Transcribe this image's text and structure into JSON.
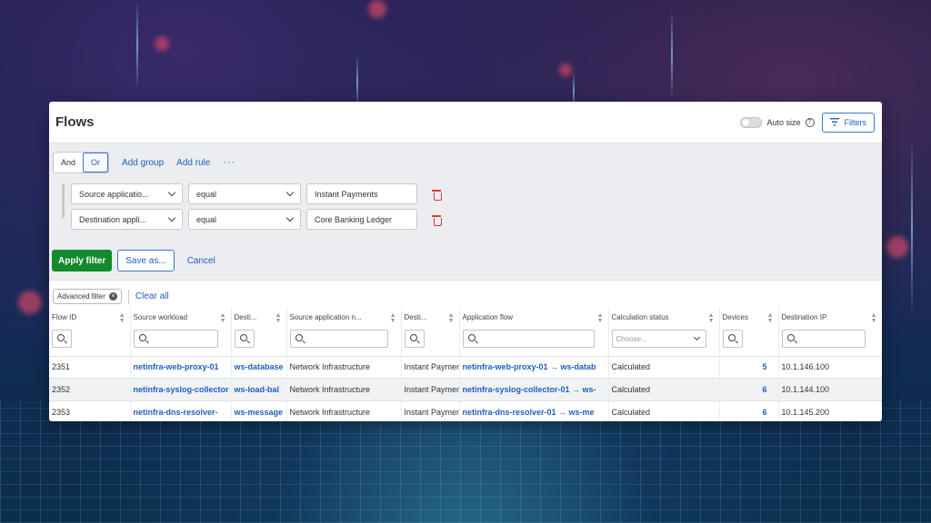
{
  "header": {
    "title": "Flows",
    "auto_size_label": "Auto size",
    "help_icon": "?",
    "filters_label": "Filters"
  },
  "filter_builder": {
    "logic": {
      "and": "And",
      "or": "Or",
      "selected": "Or"
    },
    "add_group": "Add group",
    "add_rule": "Add rule",
    "more": "···",
    "rules": [
      {
        "field": "Source applicatio...",
        "operator": "equal",
        "value": "Instant Payments"
      },
      {
        "field": "Destination appli...",
        "operator": "equal",
        "value": "Core Banking Ledger"
      }
    ],
    "apply": "Apply filter",
    "save_as": "Save as...",
    "cancel": "Cancel"
  },
  "chips": {
    "advanced_filter": "Advanced filter",
    "clear_all": "Clear all"
  },
  "table": {
    "columns": [
      {
        "label": "Flow ID"
      },
      {
        "label": "Source workload"
      },
      {
        "label": "Desti..."
      },
      {
        "label": "Source application n..."
      },
      {
        "label": "Desti..."
      },
      {
        "label": "Application flow"
      },
      {
        "label": "Calculation status",
        "placeholder": "Choose..."
      },
      {
        "label": "Devices"
      },
      {
        "label": "Destination IP"
      }
    ],
    "rows": [
      {
        "flow_id": "2351",
        "source_workload": "netinfra-web-proxy-01",
        "destination": "ws-database",
        "source_app": "Network Infrastructure",
        "dest_app": "Instant Payments",
        "app_flow": "netinfra-web-proxy-01 → ws-datab",
        "status": "Calculated",
        "devices": "5",
        "dest_ip": "10.1.146.100"
      },
      {
        "flow_id": "2352",
        "source_workload": "netinfra-syslog-collector",
        "destination": "ws-load-bal",
        "source_app": "Network Infrastructure",
        "dest_app": "Instant Payments",
        "app_flow": "netinfra-syslog-collector-01 → ws-",
        "status": "Calculated",
        "devices": "6",
        "dest_ip": "10.1.144.100"
      },
      {
        "flow_id": "2353",
        "source_workload": "netinfra-dns-resolver-",
        "destination": "ws-message",
        "source_app": "Network Infrastructure",
        "dest_app": "Instant Payments",
        "app_flow": "netinfra-dns-resolver-01 → ws-me",
        "status": "Calculated",
        "devices": "6",
        "dest_ip": "10.1.145.200"
      }
    ]
  }
}
